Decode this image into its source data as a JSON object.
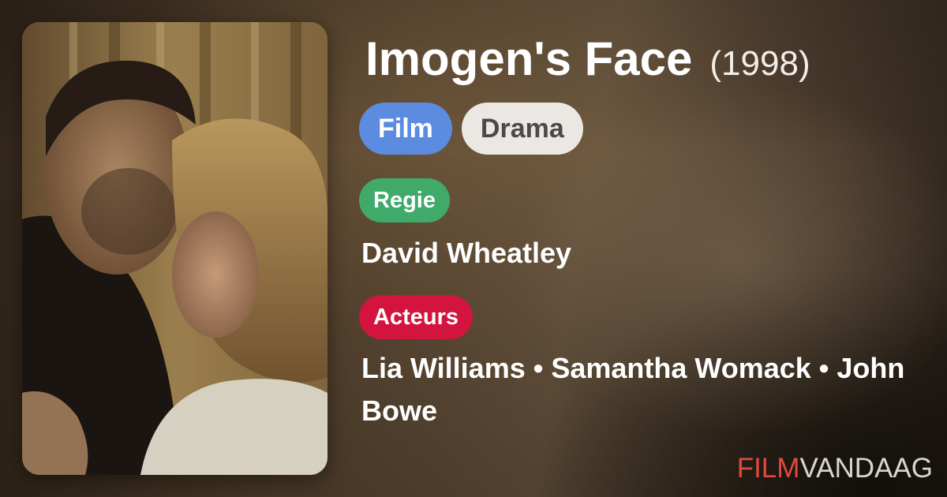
{
  "movie": {
    "title": "Imogen's Face",
    "year": "(1998)",
    "type_tag": "Film",
    "genre_tag": "Drama",
    "director_label": "Regie",
    "director": "David Wheatley",
    "cast_label": "Acteurs",
    "cast": "Lia Williams • Samantha Womack • John Bowe"
  },
  "brand": {
    "part1": "FILM",
    "part2": "VANDAAG",
    "color_part1": "#e04a3d",
    "color_part2": "#d9d6d0"
  },
  "colors": {
    "film_tag": "#5b8ce0",
    "genre_tag": "#ebe8e4",
    "regie_badge": "#3faa6a",
    "acteurs_badge": "#d2143f"
  }
}
